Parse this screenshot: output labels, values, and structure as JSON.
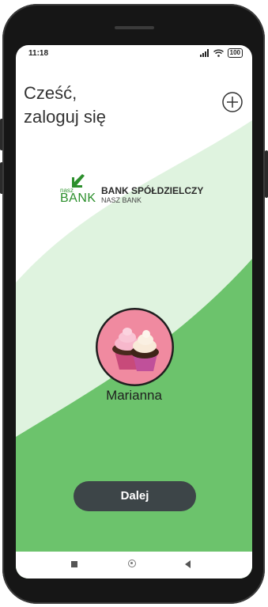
{
  "status_bar": {
    "time": "11:18",
    "battery": "100"
  },
  "greeting": "Cześć,\nzaloguj się",
  "logo": {
    "nasz": "nasz",
    "bank": "BANK",
    "title": "BANK SPÓŁDZIELCZY",
    "subtitle": "NASZ BANK"
  },
  "user": {
    "name": "Marianna"
  },
  "next_button": {
    "label": "Dalej"
  },
  "colors": {
    "accent_green_light": "#dff3df",
    "accent_green": "#6cc36c",
    "button_dark": "#3d4548",
    "brand_green": "#2c8f2c"
  },
  "icons": {
    "add": "plus-circle-icon",
    "signal": "signal-icon",
    "wifi": "wifi-icon",
    "battery": "battery-icon",
    "nav_recents": "square-icon",
    "nav_home": "circle-icon",
    "nav_back": "triangle-back-icon"
  }
}
